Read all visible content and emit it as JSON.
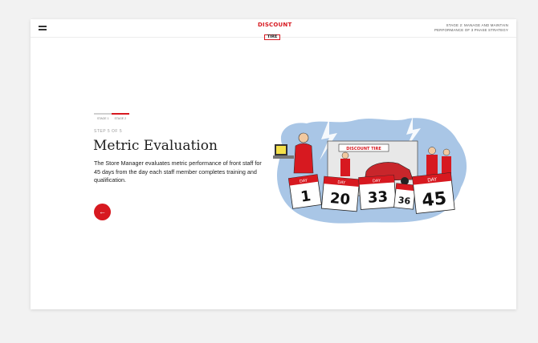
{
  "header": {
    "logo_top": "DISCOUNT",
    "logo_bottom": "TIRE",
    "stage_title_line1": "STAGE 2: MANAGE AND MAINTAIN",
    "stage_title_line2": "PERFORMANCE OF 3 PHASE STRATEGY"
  },
  "progress": {
    "stages": [
      "STAGE 1",
      "STAGE 2"
    ],
    "current_stage": 2,
    "fraction_complete": 1.0
  },
  "content": {
    "step_kicker": "STEP 5 OF 5",
    "title": "Metric Evaluation",
    "description": "The Store Manager evaluates metric performance of front staff for 45 days from the day each staff member completes training and qualification.",
    "back_icon": "←"
  },
  "illustration": {
    "store_sign": "DISCOUNT TIRE",
    "day_label": "DAY",
    "calendar_days": [
      "1",
      "20",
      "33",
      "36",
      "45"
    ]
  },
  "colors": {
    "accent": "#d71920",
    "text": "#1d1d1d",
    "muted": "#9a9a9a",
    "background": "#f2f2f2"
  }
}
